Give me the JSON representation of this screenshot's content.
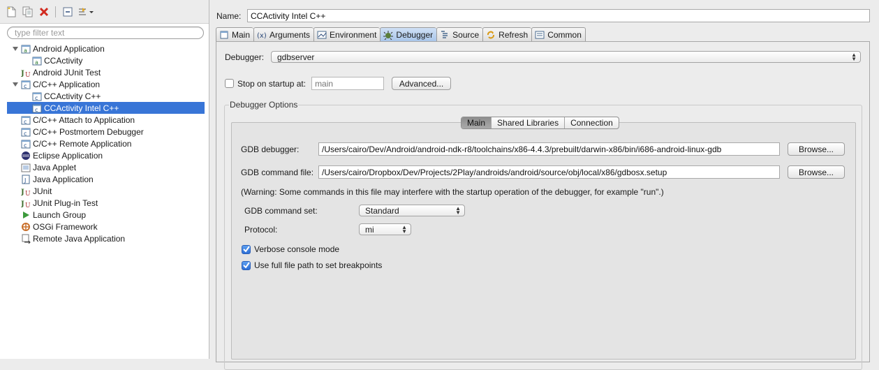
{
  "toolbar": {
    "icons": [
      "new-launch-config-icon",
      "duplicate-icon",
      "delete-icon",
      "collapse-all-icon",
      "filter-icon"
    ]
  },
  "filter": {
    "placeholder": "type filter text"
  },
  "tree": [
    {
      "label": "Android Application",
      "level": 0,
      "expanded": true,
      "icon": "android-app-icon"
    },
    {
      "label": "CCActivity",
      "level": 1,
      "icon": "android-app-icon"
    },
    {
      "label": "Android JUnit Test",
      "level": 0,
      "icon": "junit-icon"
    },
    {
      "label": "C/C++ Application",
      "level": 0,
      "expanded": true,
      "icon": "cpp-app-icon"
    },
    {
      "label": "CCActivity C++",
      "level": 1,
      "icon": "cpp-app-icon"
    },
    {
      "label": "CCActivity Intel C++",
      "level": 1,
      "icon": "cpp-app-icon",
      "selected": true
    },
    {
      "label": "C/C++ Attach to Application",
      "level": 0,
      "icon": "cpp-app-icon"
    },
    {
      "label": "C/C++ Postmortem Debugger",
      "level": 0,
      "icon": "cpp-app-icon"
    },
    {
      "label": "C/C++ Remote Application",
      "level": 0,
      "icon": "cpp-app-icon"
    },
    {
      "label": "Eclipse Application",
      "level": 0,
      "icon": "eclipse-icon"
    },
    {
      "label": "Java Applet",
      "level": 0,
      "icon": "java-applet-icon"
    },
    {
      "label": "Java Application",
      "level": 0,
      "icon": "java-app-icon"
    },
    {
      "label": "JUnit",
      "level": 0,
      "icon": "junit-icon"
    },
    {
      "label": "JUnit Plug-in Test",
      "level": 0,
      "icon": "junit-icon"
    },
    {
      "label": "Launch Group",
      "level": 0,
      "icon": "launch-group-icon"
    },
    {
      "label": "OSGi Framework",
      "level": 0,
      "icon": "osgi-icon"
    },
    {
      "label": "Remote Java Application",
      "level": 0,
      "icon": "remote-java-icon"
    }
  ],
  "name": {
    "label": "Name:",
    "value": "CCActivity Intel C++"
  },
  "tabs": [
    {
      "label": "Main",
      "icon": "main-tab-icon"
    },
    {
      "label": "Arguments",
      "icon": "arguments-icon"
    },
    {
      "label": "Environment",
      "icon": "environment-icon"
    },
    {
      "label": "Debugger",
      "icon": "debugger-icon",
      "active": true
    },
    {
      "label": "Source",
      "icon": "source-icon"
    },
    {
      "label": "Refresh",
      "icon": "refresh-icon"
    },
    {
      "label": "Common",
      "icon": "common-icon"
    }
  ],
  "debugger": {
    "label": "Debugger:",
    "value": "gdbserver",
    "stop_label": "Stop on startup at:",
    "stop_checked": false,
    "stop_placeholder": "main",
    "advanced_label": "Advanced...",
    "options_title": "Debugger Options",
    "subtabs": [
      {
        "label": "Main",
        "active": true
      },
      {
        "label": "Shared Libraries"
      },
      {
        "label": "Connection"
      }
    ],
    "gdb_debugger_label": "GDB debugger:",
    "gdb_debugger_value": "/Users/cairo/Dev/Android/android-ndk-r8/toolchains/x86-4.4.3/prebuilt/darwin-x86/bin/i686-android-linux-gdb",
    "gdb_command_file_label": "GDB command file:",
    "gdb_command_file_value": "/Users/cairo/Dropbox/Dev/Projects/2Play/androids/android/source/obj/local/x86/gdbosx.setup",
    "browse_label": "Browse...",
    "warning": "(Warning: Some commands in this file may interfere with the startup operation of the debugger, for example \"run\".)",
    "command_set_label": "GDB command set:",
    "command_set_value": "Standard",
    "protocol_label": "Protocol:",
    "protocol_value": "mi",
    "verbose_label": "Verbose console mode",
    "verbose_checked": true,
    "fullpath_label": "Use full file path to set breakpoints",
    "fullpath_checked": true
  },
  "colors": {
    "selection": "#3875d7",
    "active_tab": "#a9c6ea",
    "delete_red": "#d12a1f"
  }
}
